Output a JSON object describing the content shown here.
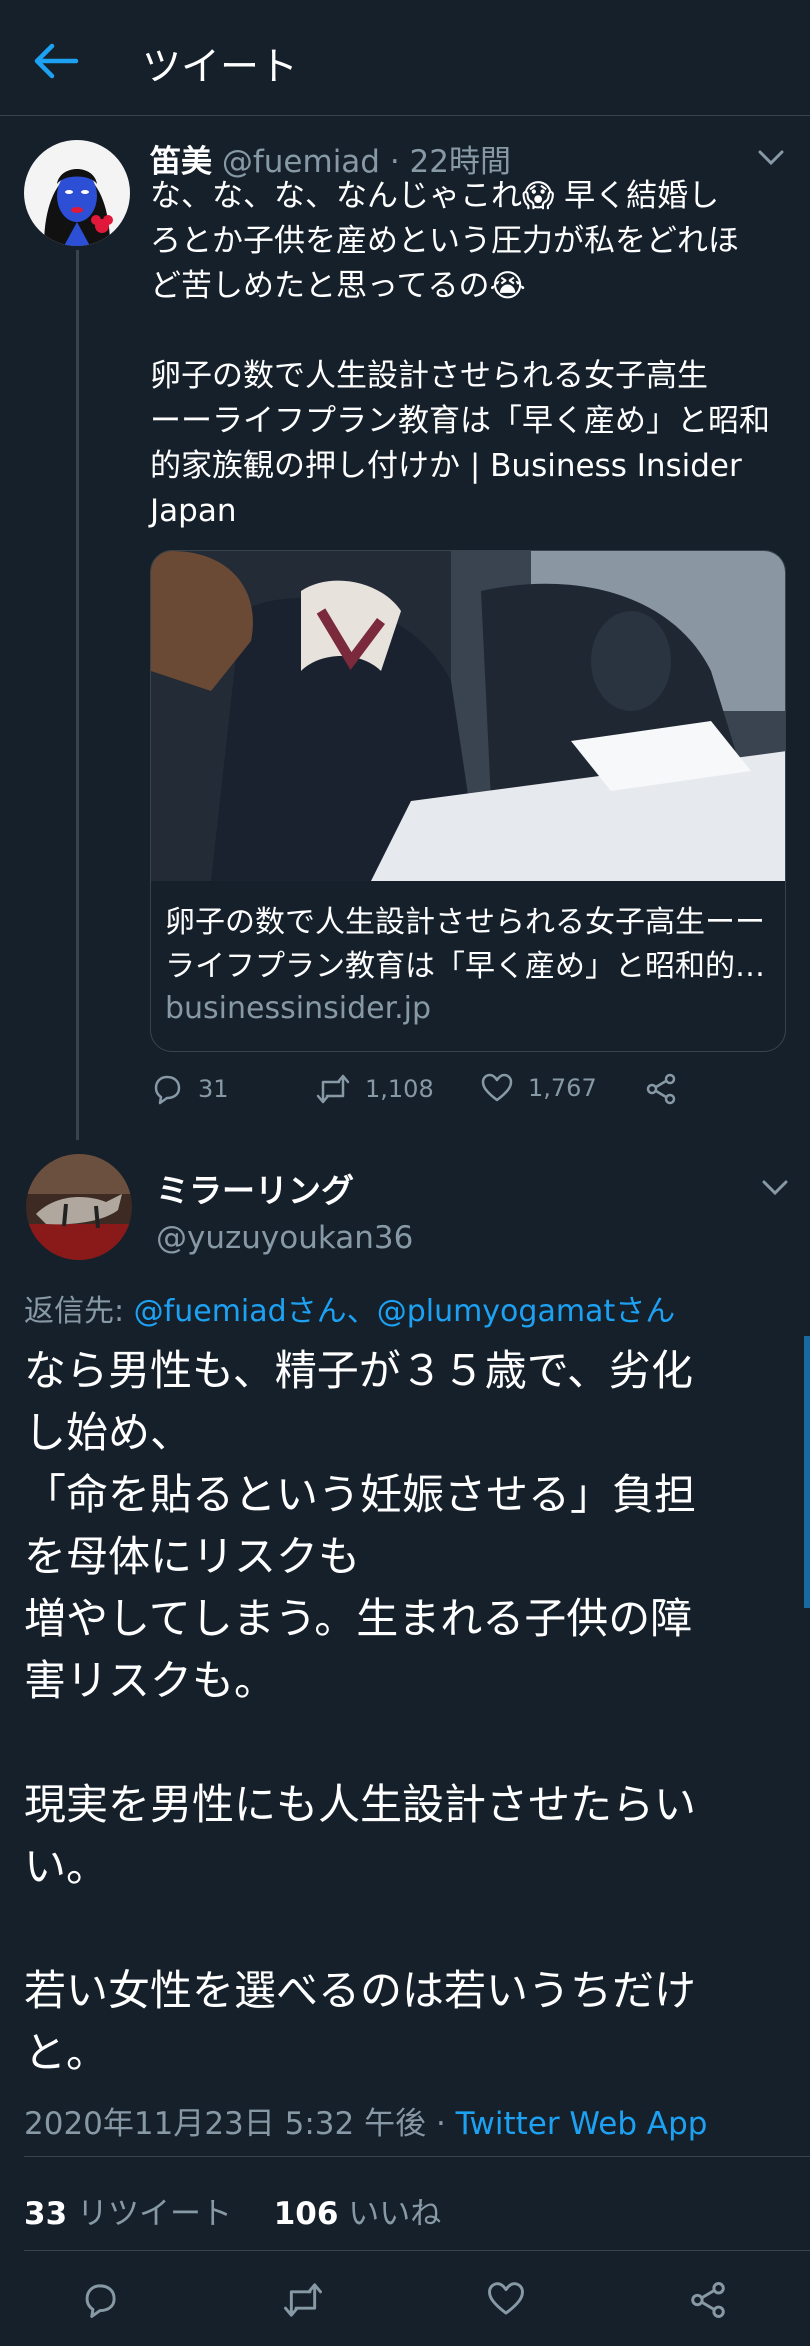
{
  "header": {
    "title": "ツイート"
  },
  "tweet1": {
    "name": "笛美",
    "handle": "@fuemiad",
    "time": "· 22時間",
    "text_lines": [
      "な、な、な、なんじゃこれ😱 早く結婚し",
      "ろとか子供を産めという圧力が私をどれほ",
      "ど苦しめたと思ってるの😭",
      "",
      "卵子の数で人生設計させられる女子高生",
      "ーーライフプラン教育は「早く産め」と昭和",
      "的家族観の押し付けか | Business Insider",
      "Japan"
    ],
    "card": {
      "title": "卵子の数で人生設計させられる女子高生ーーライフプラン教育は「早く産め」と昭和的家族観の押し付けか",
      "domain": "businessinsider.jp"
    },
    "actions": {
      "replies": "31",
      "retweets": "1,108",
      "likes": "1,767"
    }
  },
  "tweet2": {
    "name": "ミラーリング",
    "handle": "@yuzuyoukan36",
    "reply_prefix": "返信先: ",
    "reply_user1": "@fuemiadさん",
    "reply_sep": "、",
    "reply_user2": "@plumyogamatさん",
    "text_lines": [
      "なら男性も、精子が３５歳で、劣化",
      "し始め、",
      "「命を貼るという妊娠させる」負担",
      "を母体にリスクも",
      "増やしてしまう。生まれる子供の障",
      "害リスクも。",
      "",
      "現実を男性にも人生設計させたらい",
      "い。",
      "",
      "若い女性を選べるのは若いうちだけ",
      "と。"
    ],
    "timestamp": "2020年11月23日 5:32 午後 · ",
    "source": "Twitter Web App",
    "retweet_count": "33",
    "retweet_label": " リツイート",
    "like_count": "106",
    "like_label": " いいね"
  },
  "colors": {
    "background": "#15202b",
    "accent": "#1da1f2",
    "muted": "#8899a6",
    "border": "#38444d"
  }
}
